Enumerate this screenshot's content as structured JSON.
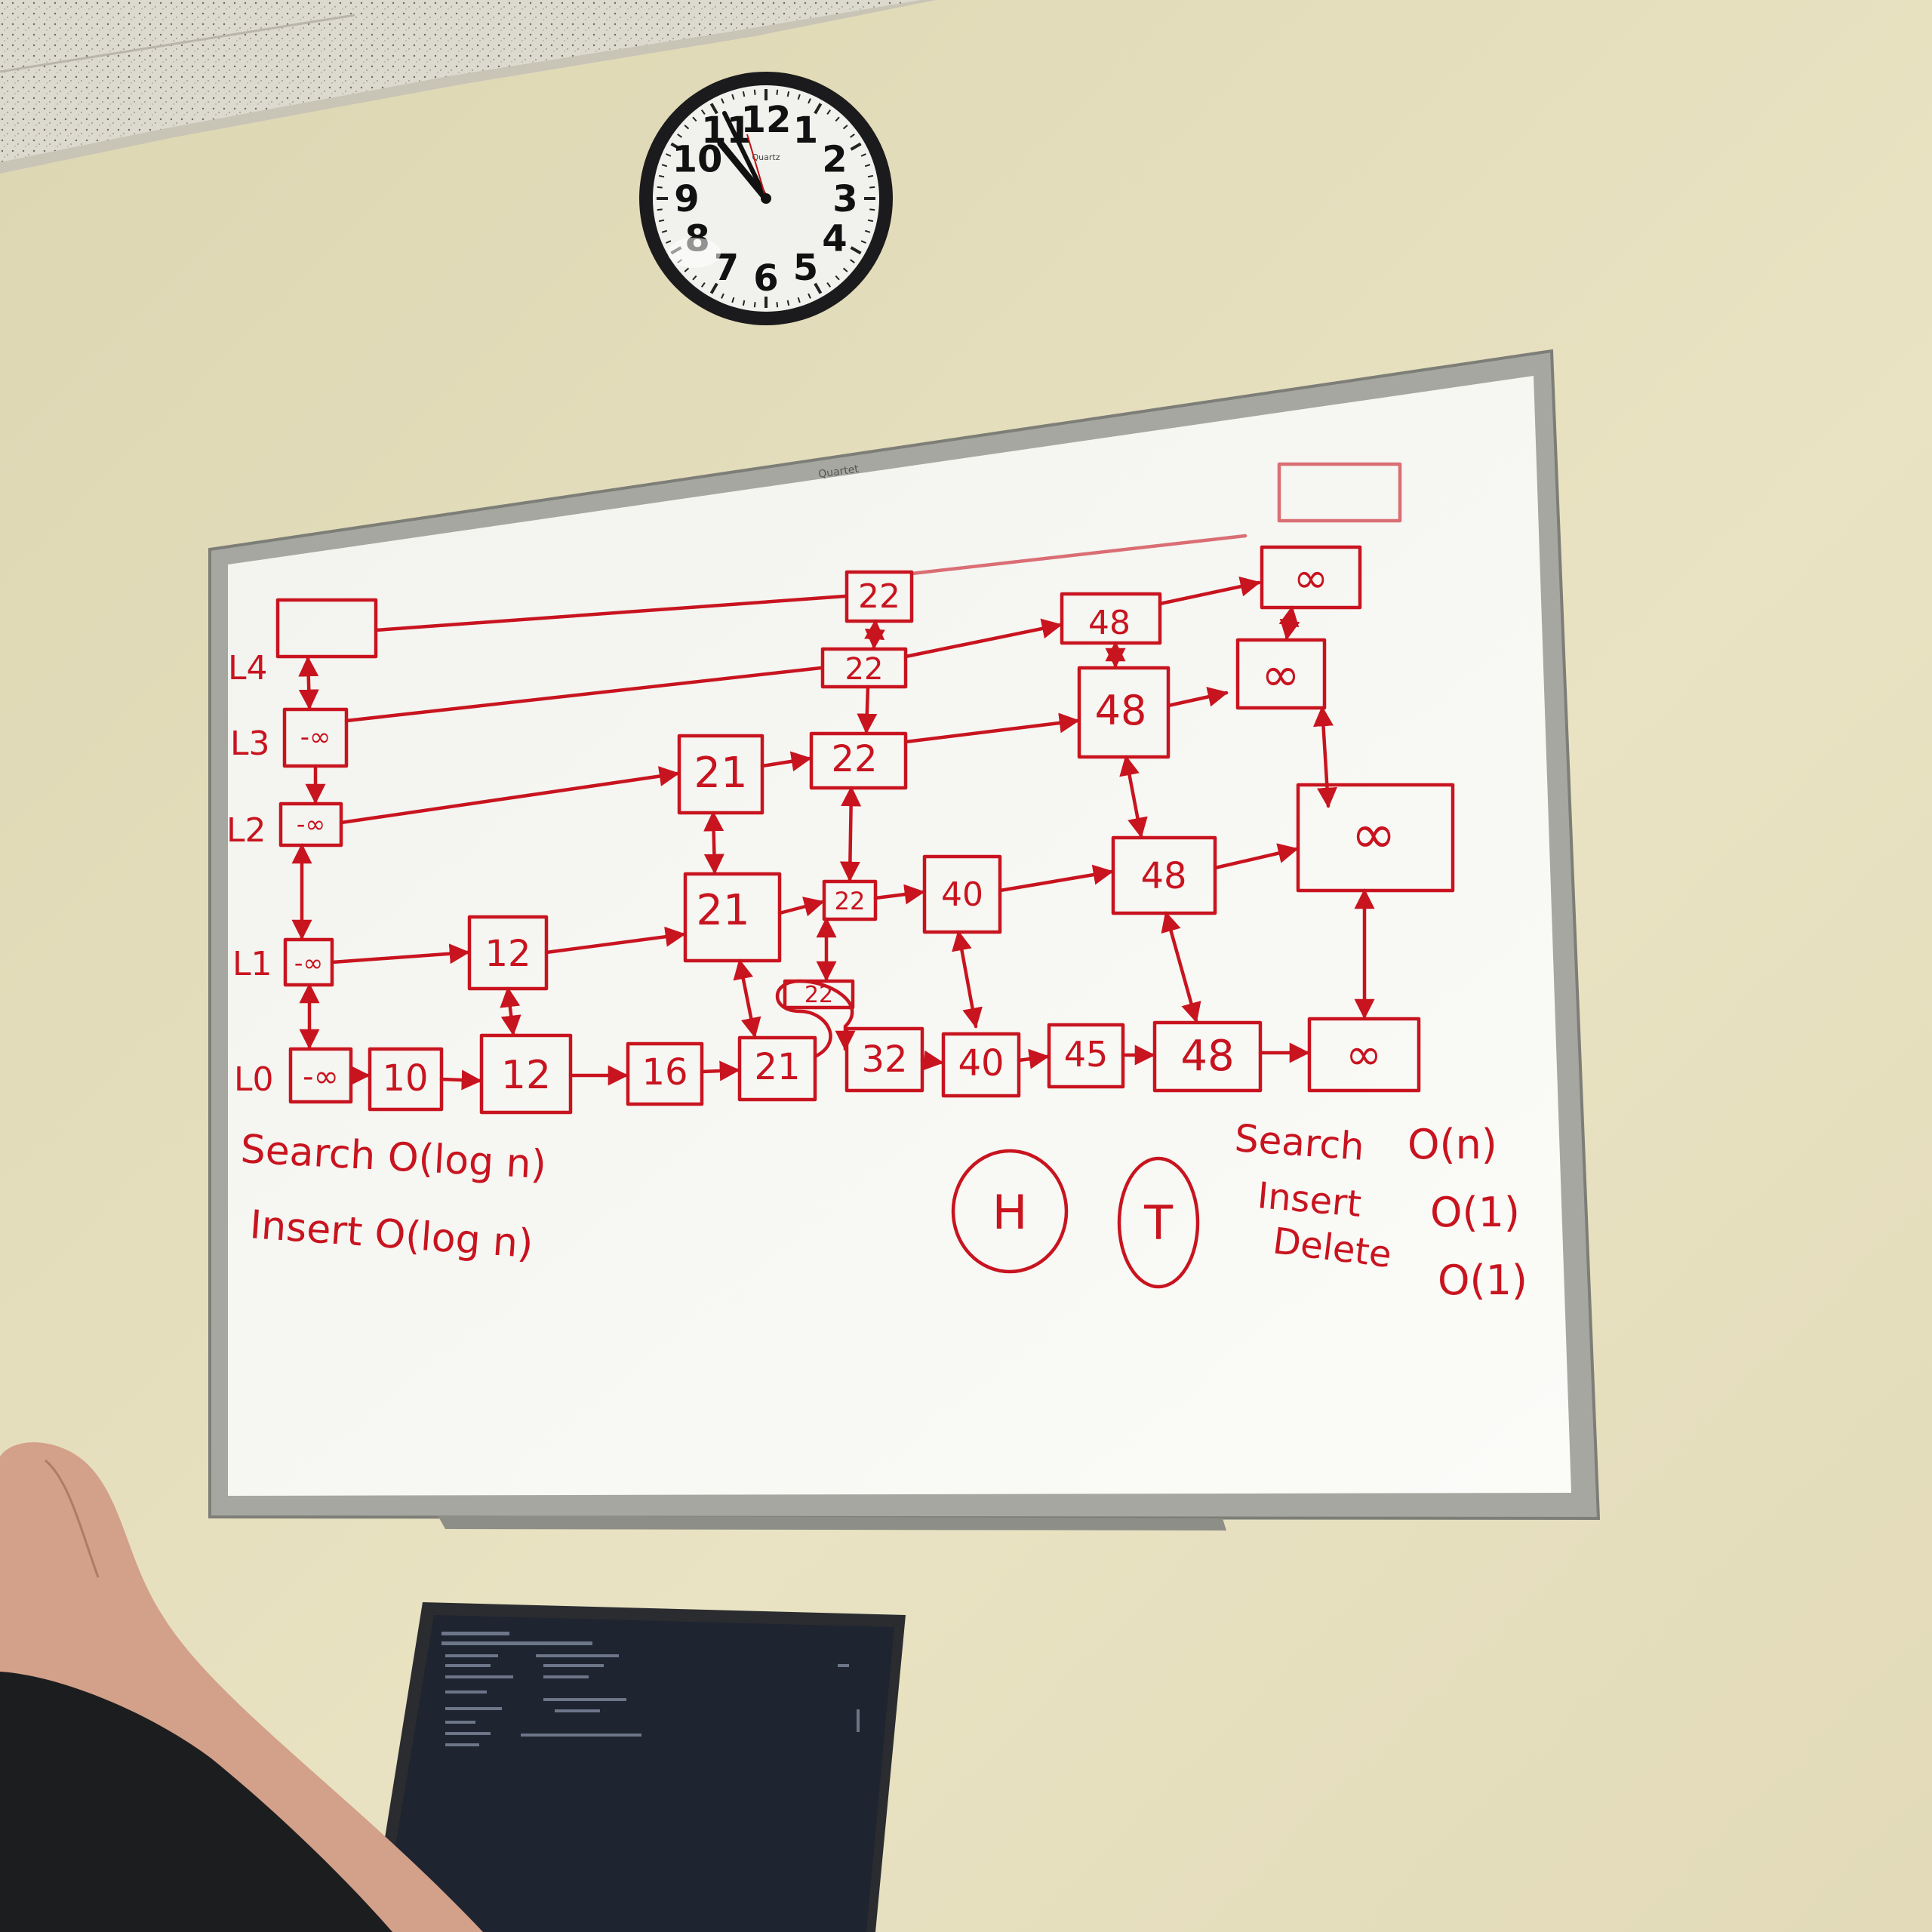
{
  "clock": {
    "brand": "Quartz",
    "numerals": [
      "12",
      "1",
      "2",
      "3",
      "4",
      "5",
      "6",
      "7",
      "8",
      "9",
      "10",
      "11"
    ],
    "time": "10:55"
  },
  "whiteboard": {
    "brand": "Quartet",
    "level_labels": [
      "L0",
      "L1",
      "L2",
      "L3",
      "L4"
    ],
    "nodes": {
      "l0": [
        "-∞",
        "10",
        "12",
        "16",
        "21",
        "32",
        "40",
        "45",
        "48",
        "∞"
      ],
      "l1": [
        "-∞",
        "12",
        "21",
        "22",
        "40",
        "48",
        "∞"
      ],
      "l1_inserted": "22",
      "l2": [
        "-∞",
        "21",
        "22",
        "48",
        "∞"
      ],
      "l3": [
        "-∞",
        "22",
        "48",
        "∞"
      ],
      "l4": [
        "",
        "22",
        "∞"
      ]
    },
    "notes_left": {
      "search": "Search O(log n)",
      "insert": "Insert O(log n)"
    },
    "notes_right": {
      "search_label": "Search",
      "search_cost": "O(n)",
      "insert_label": "Insert",
      "insert_cost": "O(1)",
      "delete_label": "Delete",
      "delete_cost": "O(1)"
    },
    "circles": [
      "H",
      "T"
    ]
  },
  "colors": {
    "marker": "#c8141f",
    "wall": "#e6e0bd",
    "board": "#f6f6f2",
    "frame": "#a7a7a2",
    "laptop_screen": "#1e2430"
  },
  "laptop": {
    "screen_state": "terminal-dark"
  }
}
